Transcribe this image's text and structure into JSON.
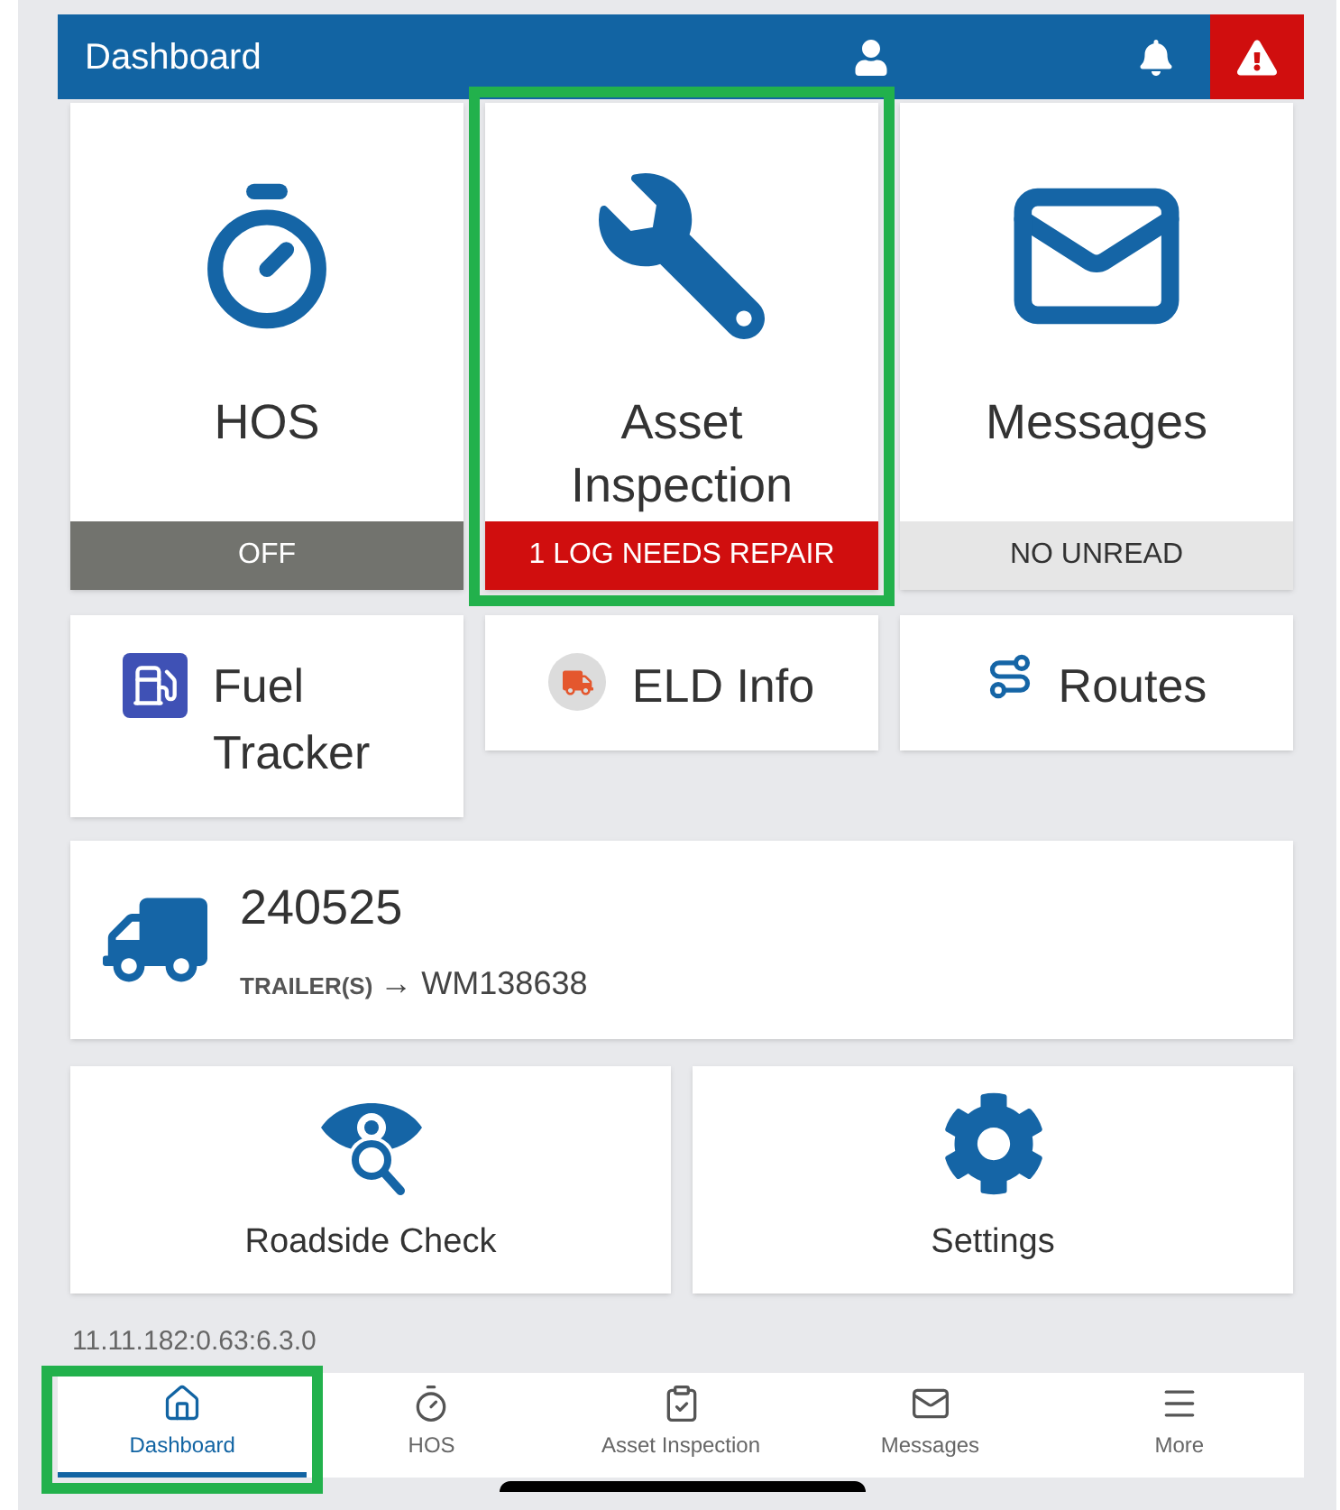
{
  "header": {
    "title": "Dashboard",
    "alert": true
  },
  "main_tiles": [
    {
      "kind": "stopwatch",
      "title": "HOS",
      "status": {
        "text": "OFF",
        "color": "#72736e"
      },
      "highlighted": false
    },
    {
      "kind": "wrench",
      "title": "Asset Inspection",
      "status": {
        "text": "1 LOG NEEDS REPAIR",
        "color": "#d00e0e"
      },
      "highlighted": true
    },
    {
      "kind": "envelope",
      "title": "Messages",
      "status": {
        "text": "NO UNREAD",
        "color": "#e6e6e6"
      },
      "highlighted": false
    }
  ],
  "small_tiles": [
    {
      "kind": "fuel",
      "title": "Fuel Tracker"
    },
    {
      "kind": "truck",
      "title": "ELD Info"
    },
    {
      "kind": "route",
      "title": "Routes"
    }
  ],
  "vehicle": {
    "number": "240525",
    "trailer_label": "TRAILER(S)",
    "trailer_value": "→ WM138638"
  },
  "bottom_tiles": [
    {
      "kind": "eye",
      "title": "Roadside Check"
    },
    {
      "kind": "gear",
      "title": "Settings"
    }
  ],
  "version": "11.11.182:0.63:6.3.0",
  "nav": [
    {
      "kind": "home",
      "label": "Dashboard",
      "selected": true,
      "highlighted": true
    },
    {
      "kind": "stopwatch",
      "label": "HOS",
      "selected": false,
      "highlighted": false
    },
    {
      "kind": "clipboard",
      "label": "Asset Inspection",
      "selected": false,
      "highlighted": false
    },
    {
      "kind": "envelope",
      "label": "Messages",
      "selected": false,
      "highlighted": false
    },
    {
      "kind": "menu",
      "label": "More",
      "selected": false,
      "highlighted": false
    }
  ]
}
